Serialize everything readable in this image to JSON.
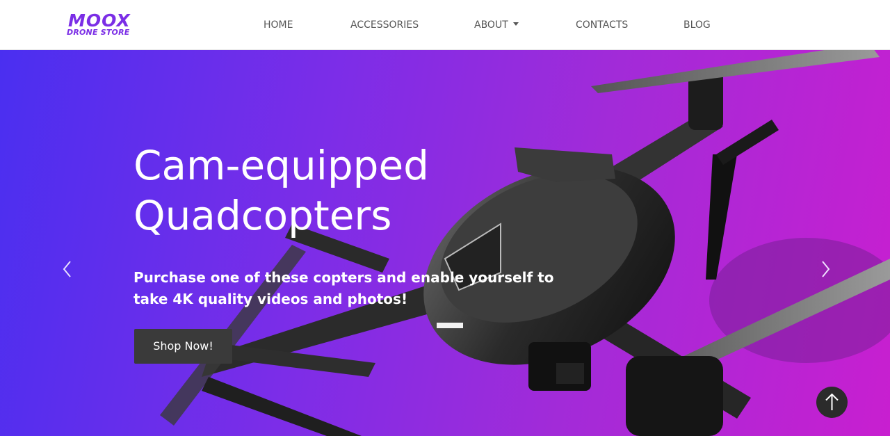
{
  "brand": {
    "name": "MOOX",
    "tagline": "DRONE STORE",
    "color": "#7b2ee6"
  },
  "nav": {
    "home": "HOME",
    "accessories": "ACCESSORIES",
    "about": "ABOUT",
    "contacts": "CONTACTS",
    "blog": "BLOG"
  },
  "hero": {
    "title": "Cam-equipped\nQuadcopters",
    "text": "Purchase one of these copters and enable yourself to take 4K quality videos and photos!",
    "cta": "Shop Now!",
    "image_subject": "carbon-fiber quadcopter drone",
    "gradient": [
      "#4a2ff0",
      "#c81fd0"
    ]
  },
  "icons": {
    "prev": "chevron-left-icon",
    "next": "chevron-right-icon",
    "scroll_top": "arrow-up-icon",
    "dropdown": "caret-down-icon"
  }
}
